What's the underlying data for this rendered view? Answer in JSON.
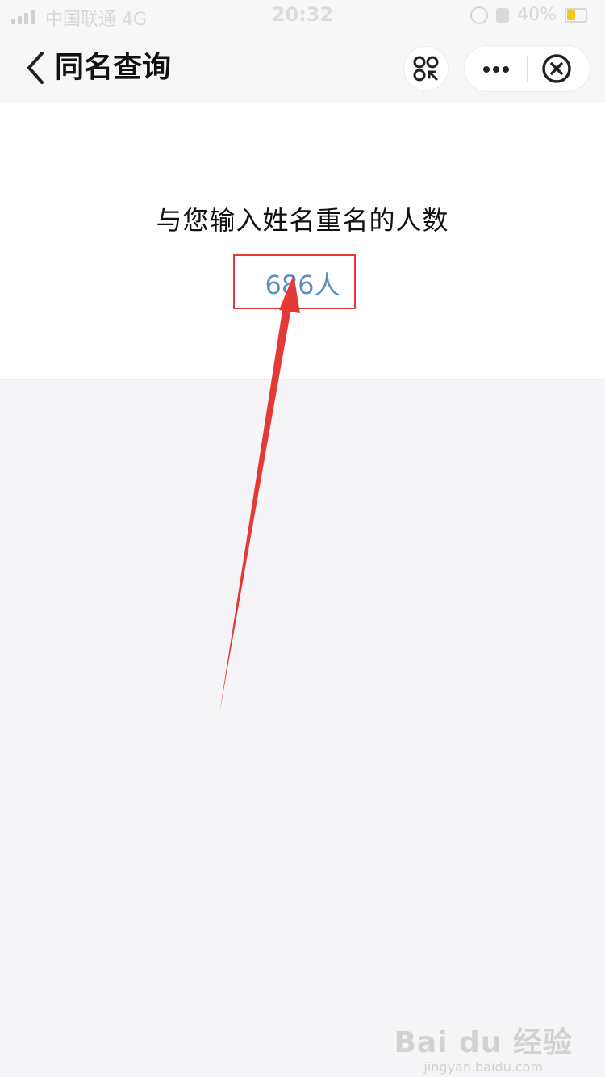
{
  "status_bar": {
    "carrier": "中国联通 4G",
    "time": "20:32",
    "battery": "40%"
  },
  "nav": {
    "title": "同名查询"
  },
  "result": {
    "label": "与您输入姓名重名的人数",
    "count": "686人"
  },
  "watermark": {
    "logo": "Bai du 经验",
    "url": "jingyan.baidu.com"
  },
  "colors": {
    "accent_blue": "#5b8ec3",
    "annotation_red": "#e53935",
    "page_background": "#f5f5f7"
  },
  "icons": [
    "chevron-left-icon",
    "scan-code-icon",
    "more-icon",
    "close-circle-icon",
    "signal-icon",
    "alarm-icon",
    "battery-icon"
  ]
}
